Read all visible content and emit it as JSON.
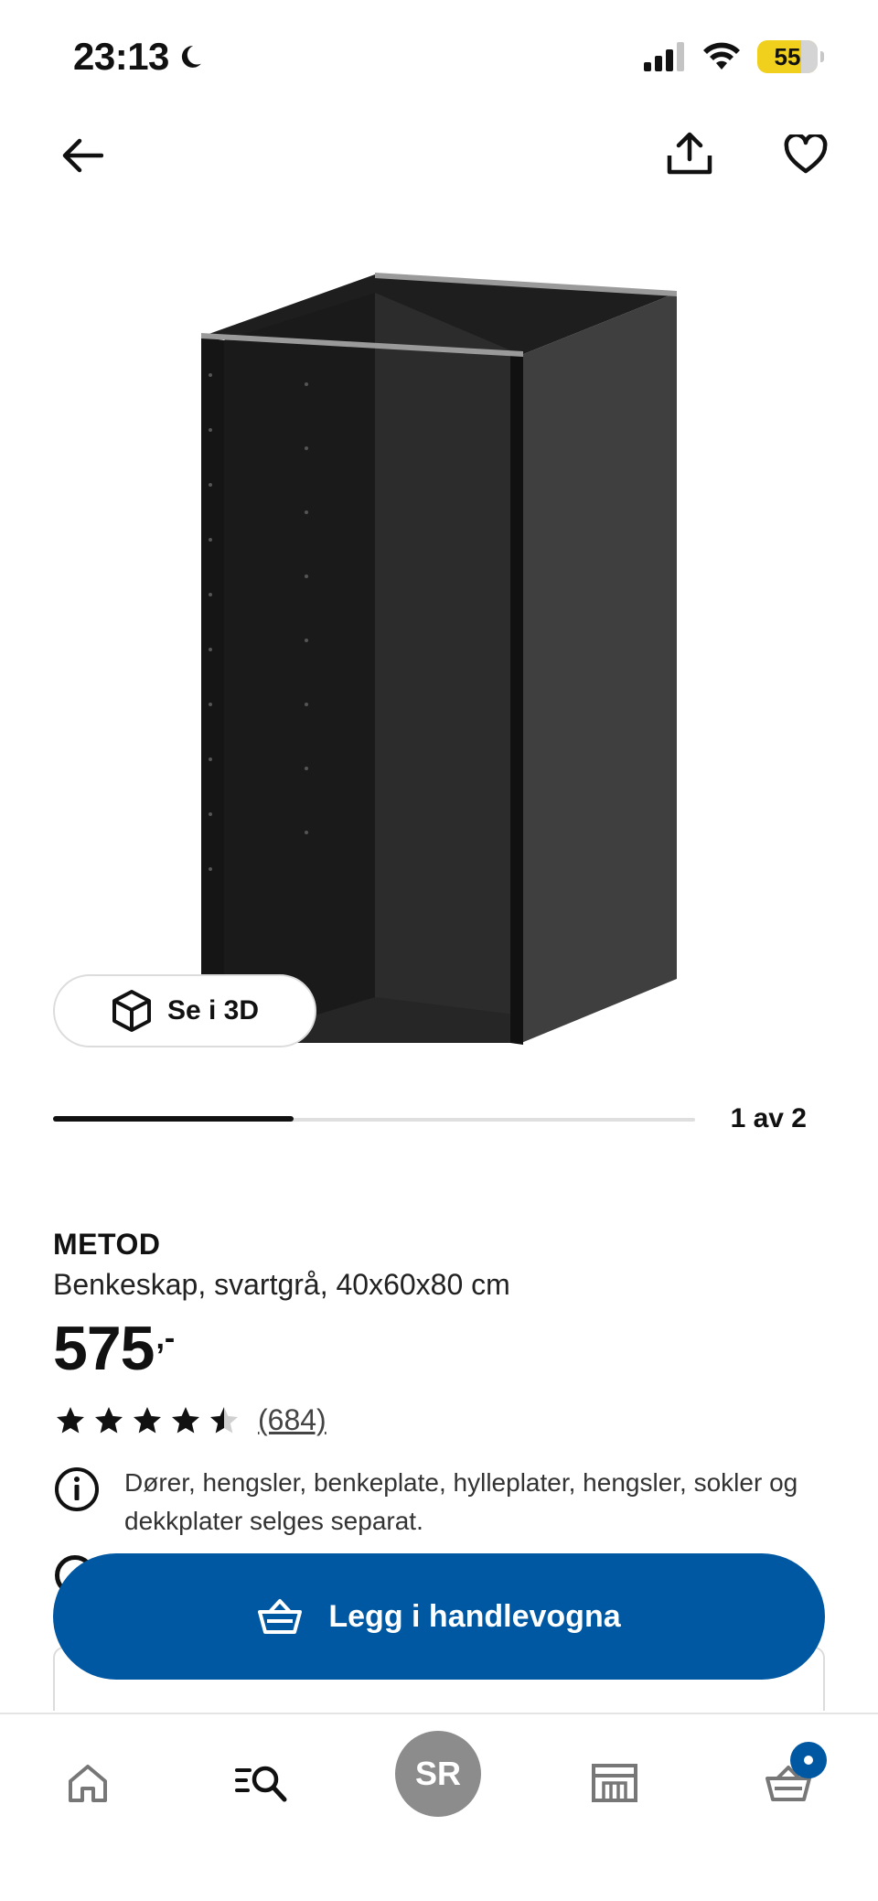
{
  "status_bar": {
    "time": "23:13",
    "battery": "55"
  },
  "product": {
    "name": "METOD",
    "description": "Benkeskap, svartgrå, 40x60x80 cm",
    "price": "575",
    "price_suffix": ",-",
    "rating_value": 4.5,
    "rating_max": 5,
    "review_count": "(684)",
    "note": "Dører, hengsler, benkeplate, hylleplater, hengsler, sokler og dekkplater selges separat."
  },
  "gallery": {
    "view_3d_label": "Se i 3D",
    "counter": "1 av 2",
    "progress_fraction": 0.375
  },
  "actions": {
    "add_to_cart_label": "Legg i handlevogna"
  },
  "bottom_nav": {
    "profile_initials": "SR",
    "items": [
      "home-icon",
      "search-icon",
      "profile-avatar",
      "stores-icon",
      "cart-icon"
    ]
  },
  "colors": {
    "primary_blue": "#0058a3",
    "battery_yellow": "#f0d01c",
    "cabinet_dark": "#2a2a2a"
  }
}
